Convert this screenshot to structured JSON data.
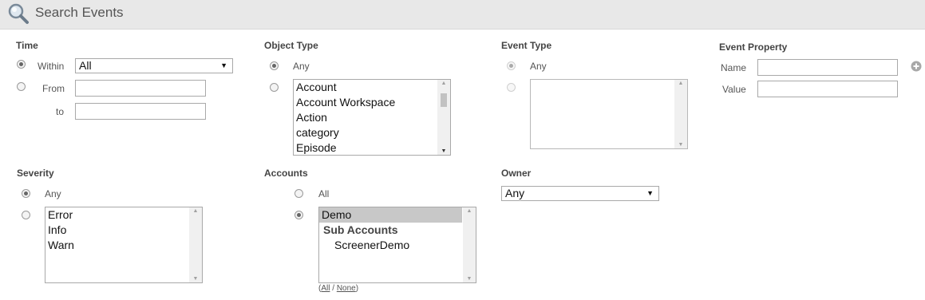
{
  "header": {
    "title": "Search Events",
    "icon": "search-icon"
  },
  "time": {
    "label": "Time",
    "within_label": "Within",
    "within_value": "All",
    "from_label": "From",
    "to_label": "to",
    "from_value": "",
    "to_value": ""
  },
  "object_type": {
    "label": "Object Type",
    "any_label": "Any",
    "items": [
      "Account",
      "Account Workspace",
      "Action",
      "category",
      "Episode"
    ]
  },
  "event_type": {
    "label": "Event Type",
    "any_label": "Any"
  },
  "event_property": {
    "label": "Event Property",
    "name_label": "Name",
    "value_label": "Value",
    "name_value": "",
    "value_value": "",
    "add_icon": "plus-circle-icon"
  },
  "severity": {
    "label": "Severity",
    "any_label": "Any",
    "items": [
      "Error",
      "Info",
      "Warn"
    ]
  },
  "accounts": {
    "label": "Accounts",
    "all_label": "All",
    "items": [
      {
        "label": "Demo"
      },
      {
        "label": "Sub Accounts"
      },
      {
        "label": "ScreenerDemo"
      }
    ],
    "links": {
      "open": "(",
      "all": "All",
      "sep": " / ",
      "none": "None",
      "close": ")"
    }
  },
  "owner": {
    "label": "Owner",
    "value": "Any"
  }
}
